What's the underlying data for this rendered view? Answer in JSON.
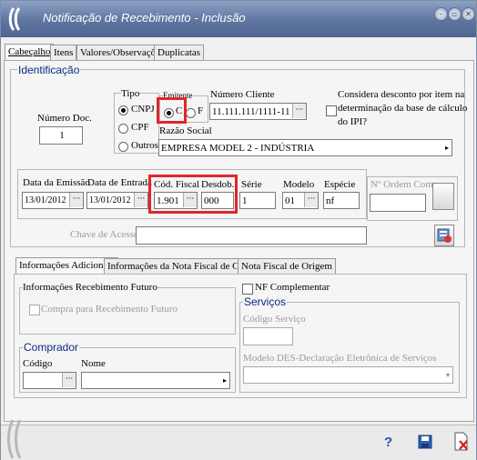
{
  "window": {
    "title": "Notificação de Recebimento - Inclusão"
  },
  "tabs": [
    "Cabeçalho",
    "Itens",
    "Valores/Observações",
    "Duplicatas"
  ],
  "identificacao": {
    "group_label": "Identificação",
    "num_doc_label": "Número Doc.",
    "num_doc_value": "1",
    "tipo_label": "Tipo",
    "tipo_options": [
      "CNPJ",
      "CPF",
      "Outros"
    ],
    "emitente_label": "Emitente",
    "emitente_options": [
      "C",
      "F"
    ],
    "numero_cliente_label": "Número Cliente",
    "numero_cliente_value": "11.111.111/1111-11",
    "desconto_label_1": "Considera desconto por item na",
    "desconto_label_2": "determinação da base de cálculo",
    "desconto_label_3": "do IPI?",
    "razao_social_label": "Razão Social",
    "razao_social_value": "EMPRESA MODEL 2 - INDÚSTRIA",
    "data_emissao_label": "Data da Emissão",
    "data_emissao_value": "13/01/2012",
    "data_entrada_label": "Data de Entrada",
    "data_entrada_value": "13/01/2012",
    "cod_fiscal_label": "Cód. Fiscal",
    "cod_fiscal_value": "1.901",
    "desdob_label": "Desdob.",
    "desdob_value": "000",
    "serie_label": "Série",
    "serie_value": "1",
    "modelo_label": "Modelo",
    "modelo_value": "01",
    "especie_label": "Espécie",
    "especie_value": "nf",
    "ordem_compra_label": "Nº Ordem Compra",
    "chave_acesso_label": "Chave de Acesso:"
  },
  "subtabs": [
    "Informações Adicionais",
    "Informações da Nota Fiscal de Compra",
    "Nota Fiscal de Origem"
  ],
  "info_adicionais": {
    "futuro_label": "Informações Recebimento Futuro",
    "futuro_check": "Compra para Recebimento Futuro",
    "nf_complementar": "NF Complementar",
    "comprador_label": "Comprador",
    "codigo_label": "Código",
    "nome_label": "Nome",
    "servicos_label": "Serviços",
    "codigo_servico_label": "Código Serviço",
    "modelo_des_label": "Modelo DES-Declaração Eletrônica de Serviços"
  },
  "icons": {
    "logo": "app-logo-icon",
    "minimize": "minimize-icon",
    "maximize": "maximize-icon",
    "close": "close-icon",
    "help": "help-icon",
    "save": "save-icon",
    "cancel": "cancel-document-icon",
    "key": "access-key-icon"
  },
  "bottom": {
    "help": "?"
  },
  "colors": {
    "titlebar": "#5e75a0",
    "group_title": "#0a2a80",
    "highlight": "#e0262b"
  }
}
